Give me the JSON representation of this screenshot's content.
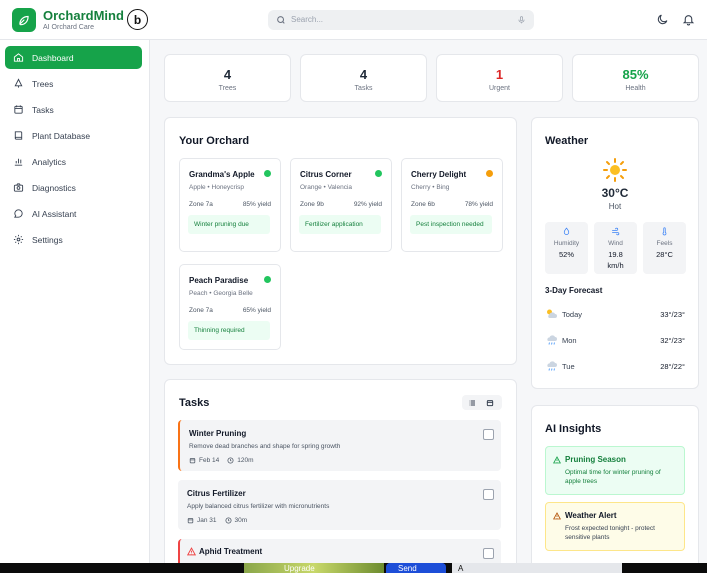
{
  "app": {
    "name": "OrchardMind",
    "subtitle": "AI Orchard Care",
    "badge": "b"
  },
  "search": {
    "placeholder": "Search..."
  },
  "nav": [
    {
      "label": "Dashboard",
      "icon": "home-icon",
      "active": true
    },
    {
      "label": "Trees",
      "icon": "tree-icon"
    },
    {
      "label": "Tasks",
      "icon": "calendar-icon"
    },
    {
      "label": "Plant Database",
      "icon": "book-icon"
    },
    {
      "label": "Analytics",
      "icon": "bar-chart-icon"
    },
    {
      "label": "Diagnostics",
      "icon": "camera-icon"
    },
    {
      "label": "AI Assistant",
      "icon": "chat-icon"
    },
    {
      "label": "Settings",
      "icon": "gear-icon"
    }
  ],
  "stats": [
    {
      "value": "4",
      "label": "Trees",
      "color": "#111827"
    },
    {
      "value": "4",
      "label": "Tasks",
      "color": "#111827"
    },
    {
      "value": "1",
      "label": "Urgent",
      "color": "#dc2626"
    },
    {
      "value": "85%",
      "label": "Health",
      "color": "#16a34a"
    }
  ],
  "orchard": {
    "title": "Your Orchard",
    "trees": [
      {
        "name": "Grandma's Apple",
        "variety": "Apple • Honeycrisp",
        "zone": "Zone 7a",
        "yield": "85% yield",
        "task": "Winter pruning due",
        "status_color": "#22c55e"
      },
      {
        "name": "Citrus Corner",
        "variety": "Orange • Valencia",
        "zone": "Zone 9b",
        "yield": "92% yield",
        "task": "Fertilizer application",
        "status_color": "#22c55e"
      },
      {
        "name": "Cherry Delight",
        "variety": "Cherry • Bing",
        "zone": "Zone 6b",
        "yield": "78% yield",
        "task": "Pest inspection needed",
        "status_color": "#f59e0b"
      },
      {
        "name": "Peach Paradise",
        "variety": "Peach • Georgia Belle",
        "zone": "Zone 7a",
        "yield": "65% yield",
        "task": "Thinning required",
        "status_color": "#22c55e"
      }
    ]
  },
  "weather": {
    "title": "Weather",
    "temp": "30°C",
    "desc": "Hot",
    "humidity_label": "Humidity",
    "humidity": "52%",
    "wind_label": "Wind",
    "wind": "19.8 km/h",
    "feels_label": "Feels",
    "feels": "28°C",
    "forecast_title": "3-Day Forecast",
    "forecast": [
      {
        "day": "Today",
        "temp": "33°/23°",
        "icon": "partly-cloudy-icon"
      },
      {
        "day": "Mon",
        "temp": "32°/23°",
        "icon": "rain-cloud-icon"
      },
      {
        "day": "Tue",
        "temp": "28°/22°",
        "icon": "rain-cloud-icon"
      }
    ]
  },
  "tasks": {
    "title": "Tasks",
    "items": [
      {
        "title": "Winter Pruning",
        "desc": "Remove dead branches and shape for spring growth",
        "date": "Feb 14",
        "duration": "120m",
        "priority": "orange"
      },
      {
        "title": "Citrus Fertilizer",
        "desc": "Apply balanced citrus fertilizer with micronutrients",
        "date": "Jan 31",
        "duration": "30m",
        "priority": "none"
      },
      {
        "title": "Aphid Treatment",
        "desc": "",
        "date": "",
        "duration": "",
        "priority": "red"
      }
    ]
  },
  "insights": {
    "title": "AI Insights",
    "items": [
      {
        "title": "Pruning Season",
        "text": "Optimal time for winter pruning of apple trees",
        "tone": "green"
      },
      {
        "title": "Weather Alert",
        "text": "Frost expected tonight - protect sensitive plants",
        "tone": "yellow"
      }
    ]
  },
  "taskbar": {
    "upgrade": "Upgrade",
    "send": "Send",
    "tools": "A"
  }
}
